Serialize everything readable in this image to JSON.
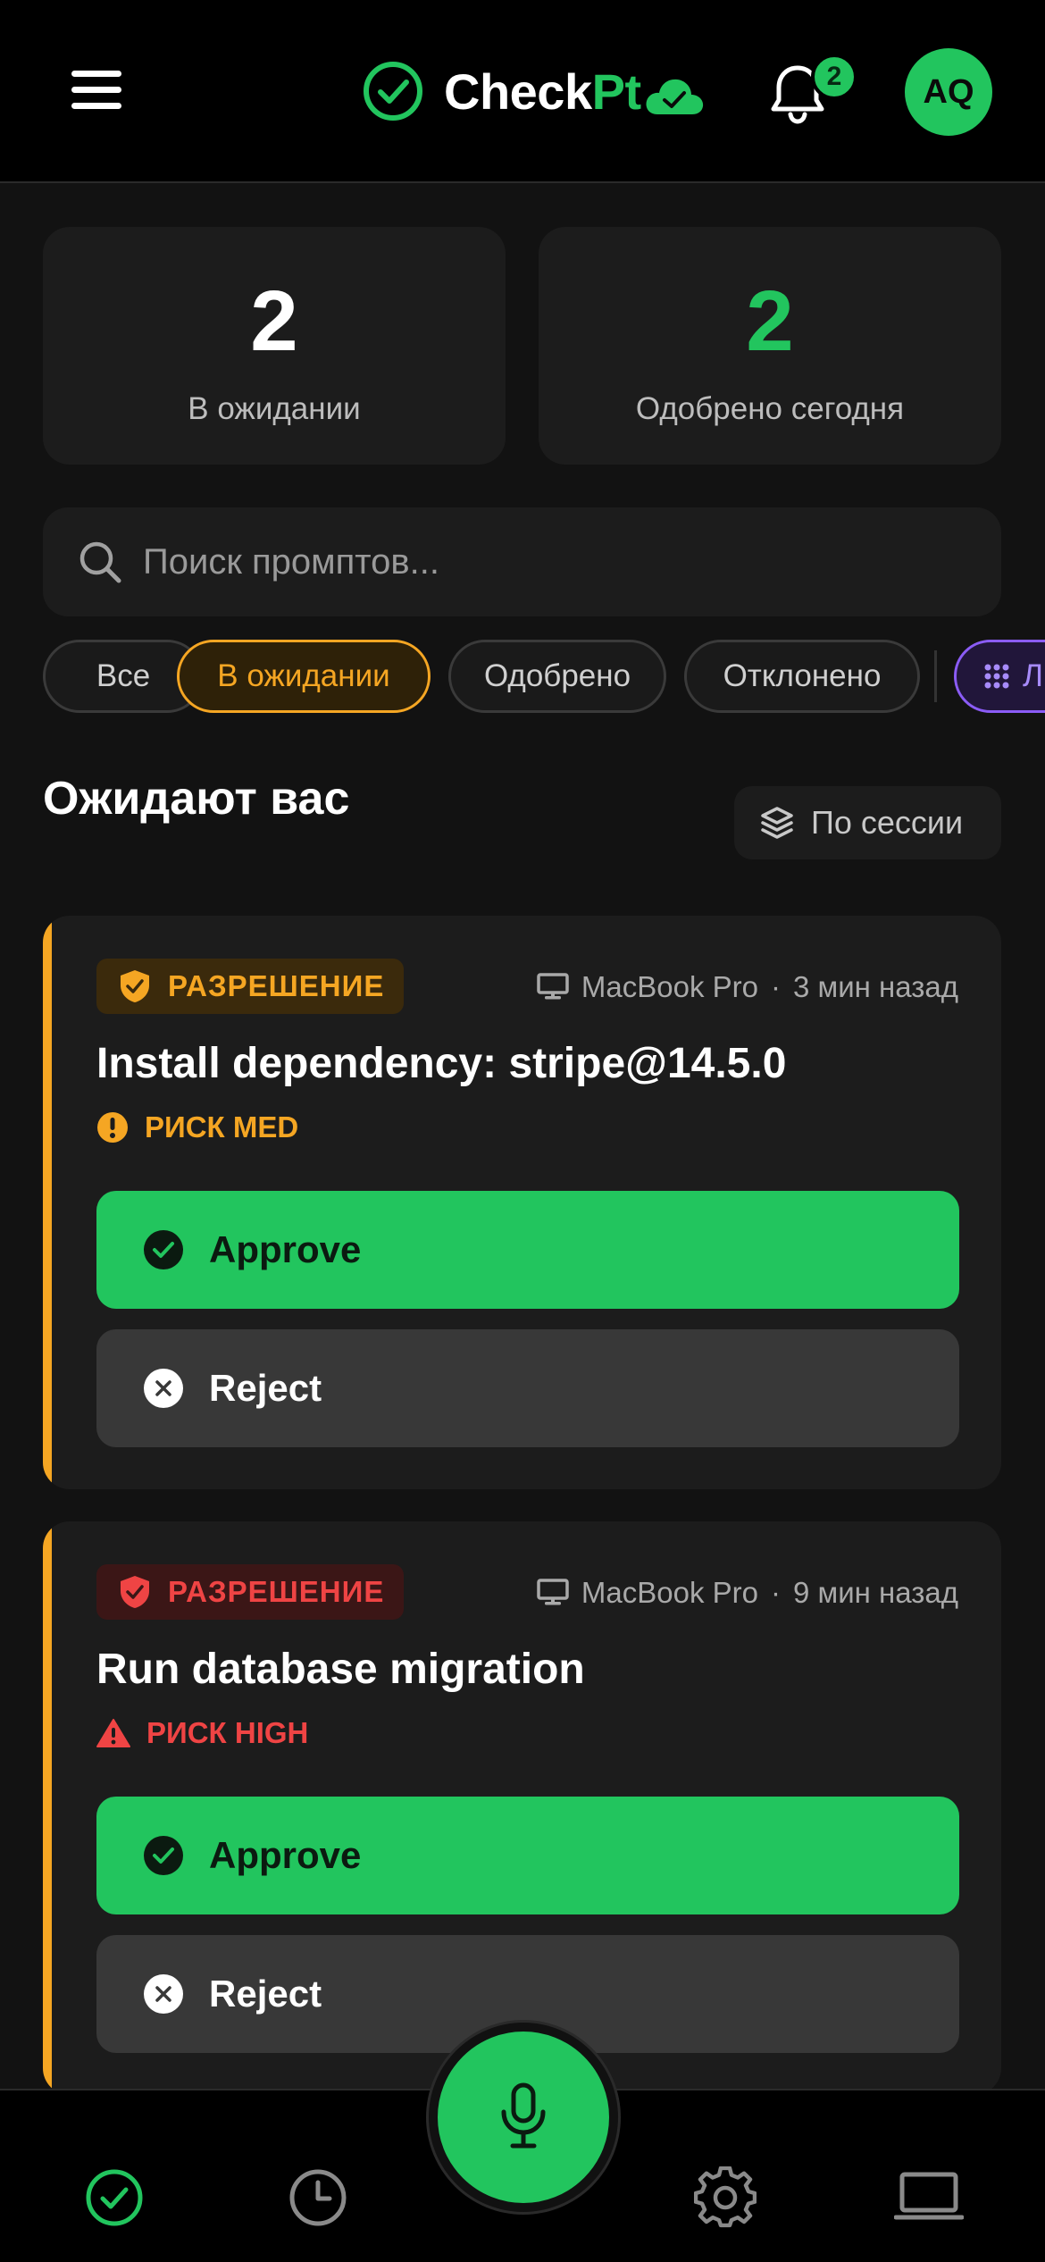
{
  "header": {
    "logo_text_a": "Check",
    "logo_text_b": "Pt",
    "notification_count": "2",
    "avatar_initials": "AQ"
  },
  "stats": [
    {
      "value": "2",
      "label": "В ожидании"
    },
    {
      "value": "2",
      "label": "Одобрено сегодня"
    }
  ],
  "search": {
    "placeholder": "Поиск промптов..."
  },
  "filters": [
    {
      "label": "Все",
      "active": false
    },
    {
      "label": "В ожидании",
      "active": true
    },
    {
      "label": "Одобрено",
      "active": false
    },
    {
      "label": "Отклонено",
      "active": false
    },
    {
      "label": "Л",
      "active": false
    }
  ],
  "section": {
    "title": "Ожидают вас",
    "group_button": "По сессии"
  },
  "cards": [
    {
      "badge": "РАЗРЕШЕНИЕ",
      "device": "MacBook Pro",
      "separator": "·",
      "time": "3 мин назад",
      "title": "Install dependency: stripe@14.5.0",
      "risk": "РИСК MED",
      "approve_label": "Approve",
      "reject_label": "Reject"
    },
    {
      "badge": "РАЗРЕШЕНИЕ",
      "device": "MacBook Pro",
      "separator": "·",
      "time": "9 мин назад",
      "title": "Run database migration",
      "risk": "РИСК HIGH",
      "approve_label": "Approve",
      "reject_label": "Reject"
    }
  ],
  "colors": {
    "accent_green": "#22c55e",
    "pending_orange": "#f5a623",
    "danger_red": "#ef4444",
    "purple": "#8b5cf6"
  },
  "icons": [
    "menu-icon",
    "checkmark-circle-icon",
    "cloud-check-icon",
    "bell-icon",
    "search-icon",
    "layers-icon",
    "shield-check-icon",
    "monitor-icon",
    "warning-circle-icon",
    "warning-triangle-icon",
    "check-circle-icon",
    "x-circle-icon",
    "clock-icon",
    "microphone-icon",
    "gear-icon",
    "laptop-icon",
    "grid-icon"
  ]
}
